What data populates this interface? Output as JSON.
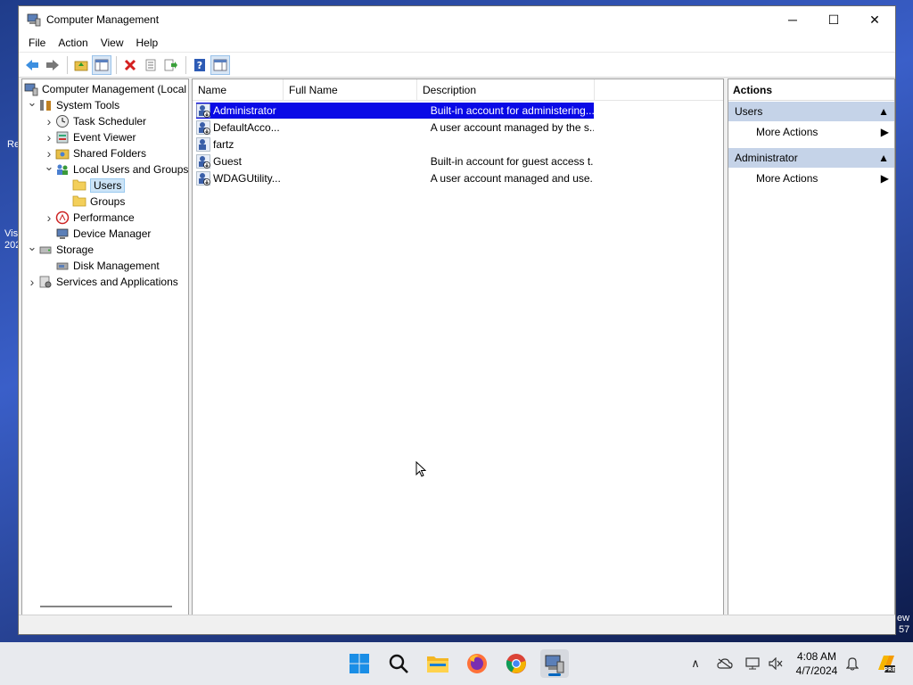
{
  "window": {
    "title": "Computer Management",
    "controls": {
      "minimize": "─",
      "maximize": "☐",
      "close": "✕"
    }
  },
  "menu": [
    "File",
    "Action",
    "View",
    "Help"
  ],
  "toolbar": [
    "back-icon",
    "forward-icon",
    "up-folder-icon",
    "show-hide-tree-icon",
    "delete-icon",
    "properties-icon",
    "export-list-icon",
    "help-icon",
    "show-hide-action-pane-icon"
  ],
  "tree": {
    "root": "Computer Management (Local",
    "items": [
      {
        "label": "System Tools",
        "level": 1,
        "state": "expanded",
        "icon": "tools-icon"
      },
      {
        "label": "Task Scheduler",
        "level": 2,
        "state": "collapsed",
        "icon": "clock-icon"
      },
      {
        "label": "Event Viewer",
        "level": 2,
        "state": "collapsed",
        "icon": "event-viewer-icon"
      },
      {
        "label": "Shared Folders",
        "level": 2,
        "state": "collapsed",
        "icon": "shared-folder-icon"
      },
      {
        "label": "Local Users and Groups",
        "level": 2,
        "state": "expanded",
        "icon": "users-group-icon"
      },
      {
        "label": "Users",
        "level": 3,
        "state": "leaf",
        "icon": "folder-icon",
        "selected": true
      },
      {
        "label": "Groups",
        "level": 3,
        "state": "leaf",
        "icon": "folder-icon"
      },
      {
        "label": "Performance",
        "level": 2,
        "state": "collapsed",
        "icon": "performance-icon"
      },
      {
        "label": "Device Manager",
        "level": 2,
        "state": "leaf",
        "icon": "device-manager-icon"
      },
      {
        "label": "Storage",
        "level": 1,
        "state": "expanded",
        "icon": "storage-icon"
      },
      {
        "label": "Disk Management",
        "level": 2,
        "state": "leaf",
        "icon": "disk-icon"
      },
      {
        "label": "Services and Applications",
        "level": 1,
        "state": "collapsed",
        "icon": "services-icon"
      }
    ]
  },
  "list": {
    "columns": [
      "Name",
      "Full Name",
      "Description"
    ],
    "rows": [
      {
        "name": "Administrator",
        "full_name": "",
        "description": "Built-in account for administering...",
        "selected": true,
        "disabled": true
      },
      {
        "name": "DefaultAcco...",
        "full_name": "",
        "description": "A user account managed by the s...",
        "disabled": true
      },
      {
        "name": "fartz",
        "full_name": "",
        "description": "",
        "disabled": false
      },
      {
        "name": "Guest",
        "full_name": "",
        "description": "Built-in account for guest access t...",
        "disabled": true
      },
      {
        "name": "WDAGUtility...",
        "full_name": "",
        "description": "A user account managed and use...",
        "disabled": true
      }
    ]
  },
  "actions": {
    "title": "Actions",
    "sections": [
      {
        "header": "Users",
        "items": [
          "More Actions"
        ]
      },
      {
        "header": "Administrator",
        "items": [
          "More Actions"
        ]
      }
    ]
  },
  "desktop_fragments": [
    "Re",
    "Vis",
    "202",
    "ew",
    "57"
  ],
  "taskbar": {
    "apps": [
      "windows-start-icon",
      "search-icon",
      "file-explorer-icon",
      "firefox-icon",
      "chrome-icon",
      "computer-management-icon"
    ],
    "time": "4:08 AM",
    "date": "4/7/2024"
  },
  "colors": {
    "selection": "#0a0ae6",
    "action_header": "#c5d3e8",
    "tree_selected": "#cce4f7"
  }
}
